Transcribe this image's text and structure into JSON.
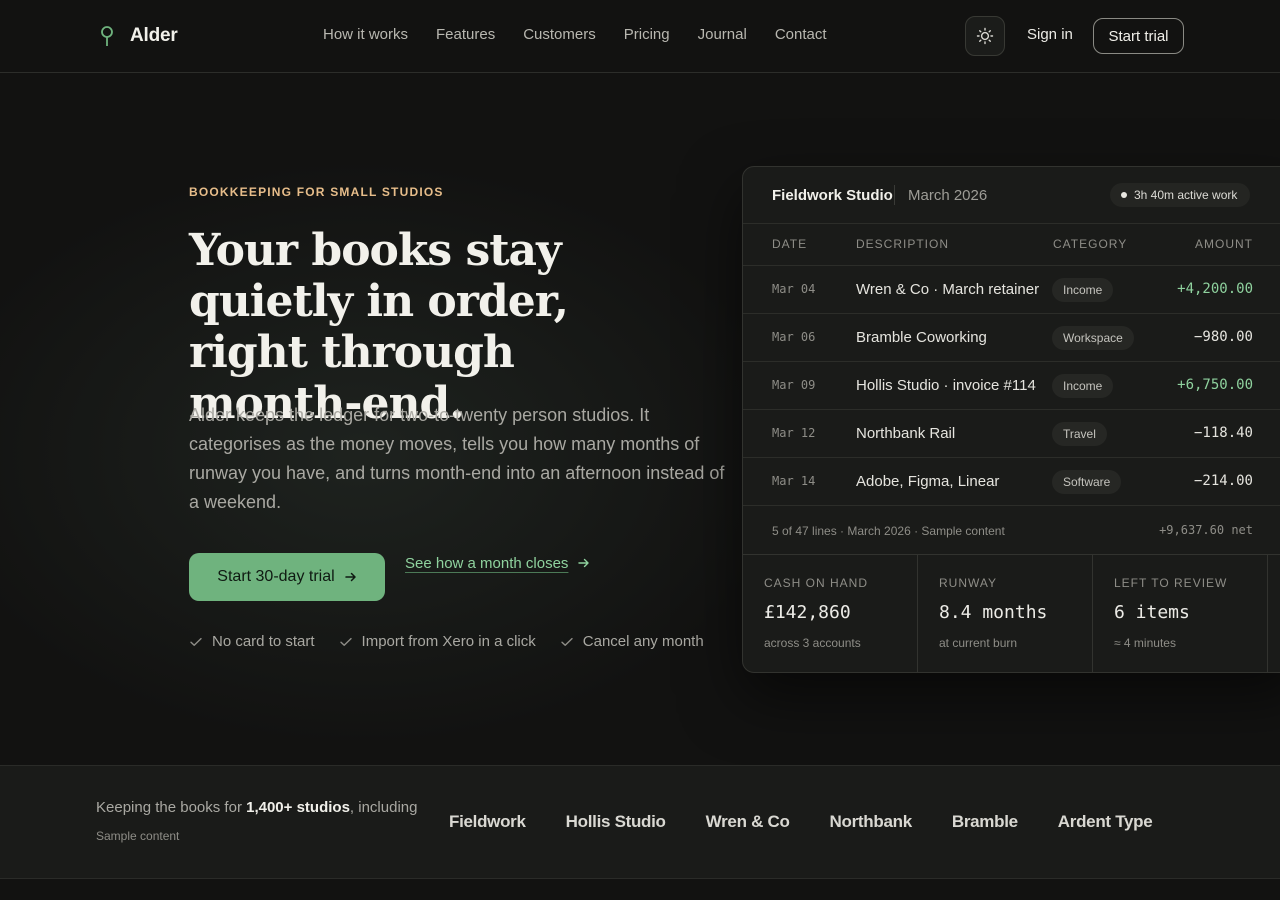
{
  "brand": {
    "name": "Alder"
  },
  "nav": {
    "links": [
      "How it works",
      "Features",
      "Customers",
      "Pricing",
      "Journal",
      "Contact"
    ],
    "sign_in": "Sign in",
    "start_trial": "Start trial"
  },
  "hero": {
    "eyebrow": "BOOKKEEPING FOR SMALL STUDIOS",
    "headline": "Your books stay quietly in order, right through month-end.",
    "lede": "Alder keeps the ledger for two-to-twenty person studios. It categorises as the money moves, tells you how many months of runway you have, and turns month-end into an afternoon instead of a weekend.",
    "cta_primary": "Start 30-day trial",
    "cta_secondary": "See how a month closes",
    "assurances": [
      "No card to start",
      "Import from Xero in a click",
      "Cancel any month"
    ]
  },
  "ledger": {
    "studio": "Fieldwork Studio",
    "month": "March 2026",
    "badge": "3h 40m active work",
    "columns": [
      "DATE",
      "DESCRIPTION",
      "CATEGORY",
      "AMOUNT"
    ],
    "rows": [
      {
        "date": "Mar 04",
        "description": "Wren & Co · March retainer",
        "category": "Income",
        "amount": "+4,200.00"
      },
      {
        "date": "Mar 06",
        "description": "Bramble Coworking",
        "category": "Workspace",
        "amount": "−980.00"
      },
      {
        "date": "Mar 09",
        "description": "Hollis Studio · invoice #114",
        "category": "Income",
        "amount": "+6,750.00"
      },
      {
        "date": "Mar 12",
        "description": "Northbank Rail",
        "category": "Travel",
        "amount": "−118.40"
      },
      {
        "date": "Mar 14",
        "description": "Adobe, Figma, Linear",
        "category": "Software",
        "amount": "−214.00"
      }
    ],
    "footer_meta": "5 of 47 lines · March 2026 · Sample content",
    "footer_net": "+9,637.60 net",
    "stats": [
      {
        "label": "CASH ON HAND",
        "value": "£142,860",
        "sub": "across 3 accounts"
      },
      {
        "label": "RUNWAY",
        "value": "8.4 months",
        "sub": "at current burn"
      },
      {
        "label": "LEFT TO REVIEW",
        "value": "6 items",
        "sub": "≈ 4 minutes"
      }
    ]
  },
  "logos": {
    "lead_prefix": "Keeping the books for ",
    "lead_count": "1,400+ studios",
    "lead_suffix": ", including",
    "sample": "Sample content",
    "names": [
      "Fieldwork",
      "Hollis Studio",
      "Wren & Co",
      "Northbank",
      "Bramble",
      "Ardent Type"
    ]
  },
  "colors": {
    "accent": "#6fb37e",
    "eyebrow": "#e7bd8a",
    "background": "#121211"
  }
}
